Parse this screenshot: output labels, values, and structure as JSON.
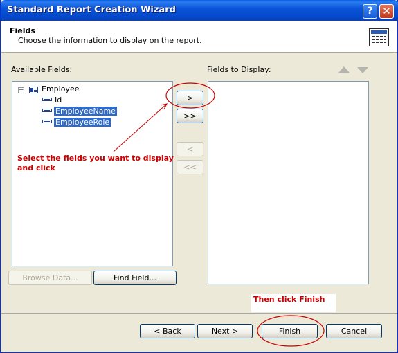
{
  "window": {
    "title": "Standard Report Creation Wizard",
    "help_glyph": "?",
    "close_glyph": "✕"
  },
  "header": {
    "title": "Fields",
    "subtitle": "Choose the information to display on the report.",
    "icon": "report-table-icon"
  },
  "available": {
    "label": "Available Fields:",
    "tree": {
      "expander_glyph": "−",
      "root": "Employee",
      "children": [
        "Id",
        "EmployeeName",
        "EmployeeRole"
      ],
      "selected": [
        "EmployeeName",
        "EmployeeRole"
      ]
    }
  },
  "display": {
    "label": "Fields to Display:",
    "items": []
  },
  "move_buttons": {
    "add": ">",
    "add_all": ">>",
    "remove": "<",
    "remove_all": "<<"
  },
  "lower_buttons": {
    "browse": "Browse Data...",
    "find": "Find Field..."
  },
  "footer": {
    "back": "< Back",
    "next": "Next >",
    "finish": "Finish",
    "cancel": "Cancel"
  },
  "annotations": {
    "select_text_line1": "Select the fields you want to display",
    "select_text_line2": "and click",
    "finish_text": "Then click Finish",
    "color": "#CC0000"
  },
  "colors": {
    "titlebar": "#0347C9",
    "selection": "#316AC5",
    "dialog": "#ECE9D8"
  }
}
